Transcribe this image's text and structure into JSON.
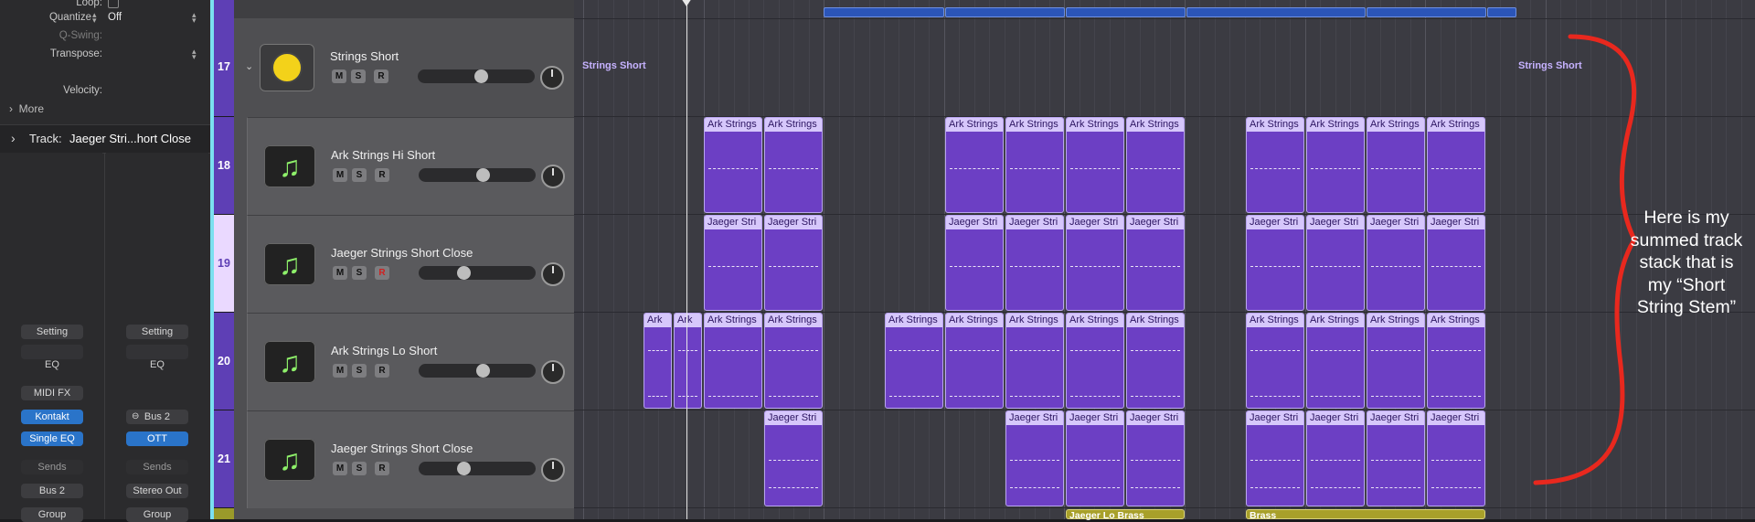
{
  "inspector": {
    "loop_label": "Loop:",
    "quantize_label": "Quantize",
    "quantize_value": "Off",
    "qswing_label": "Q-Swing:",
    "transpose_label": "Transpose:",
    "velocity_label": "Velocity:",
    "more_label": "More",
    "track_label": "Track:",
    "track_value": "Jaeger Stri...hort Close",
    "strip1": {
      "setting": "Setting",
      "eq": "EQ",
      "midi_fx": "MIDI FX",
      "instrument": "Kontakt",
      "audio_fx": "Single EQ",
      "sends": "Sends",
      "output": "Bus 2",
      "group": "Group"
    },
    "strip2": {
      "setting": "Setting",
      "eq": "EQ",
      "input": "Bus 2",
      "audio_fx": "OTT",
      "sends": "Sends",
      "output": "Stereo Out",
      "group": "Group"
    }
  },
  "tracks": [
    {
      "number": "17",
      "name": "Strings Short",
      "m": "M",
      "s": "S",
      "r": "R"
    },
    {
      "number": "18",
      "name": "Ark Strings Hi Short",
      "m": "M",
      "s": "S",
      "r": "R"
    },
    {
      "number": "19",
      "name": "Jaeger Strings Short Close",
      "m": "M",
      "s": "S",
      "r": "R"
    },
    {
      "number": "20",
      "name": "Ark Strings Lo Short",
      "m": "M",
      "s": "S",
      "r": "R"
    },
    {
      "number": "21",
      "name": "Jaeger Strings Short Close",
      "m": "M",
      "s": "S",
      "r": "R"
    }
  ],
  "folder_region_label": "Strings Short",
  "region_labels": {
    "ark": "Ark Strings",
    "ark_short": "Ark",
    "jaeger": "Jaeger Stri",
    "jaeger_lo_brass": "Jaeger Lo Brass",
    "brass": "Brass"
  },
  "annotation": "Here is my summed track stack that is my “Short String Stem”",
  "colors": {
    "region": "#6c3fc4",
    "region_header": "#d6c7fb",
    "folder_number": "#5e3fb5",
    "brass_region": "#a8a02a",
    "annotation_stroke": "#e8281e",
    "button_blue": "#2a74c9"
  }
}
